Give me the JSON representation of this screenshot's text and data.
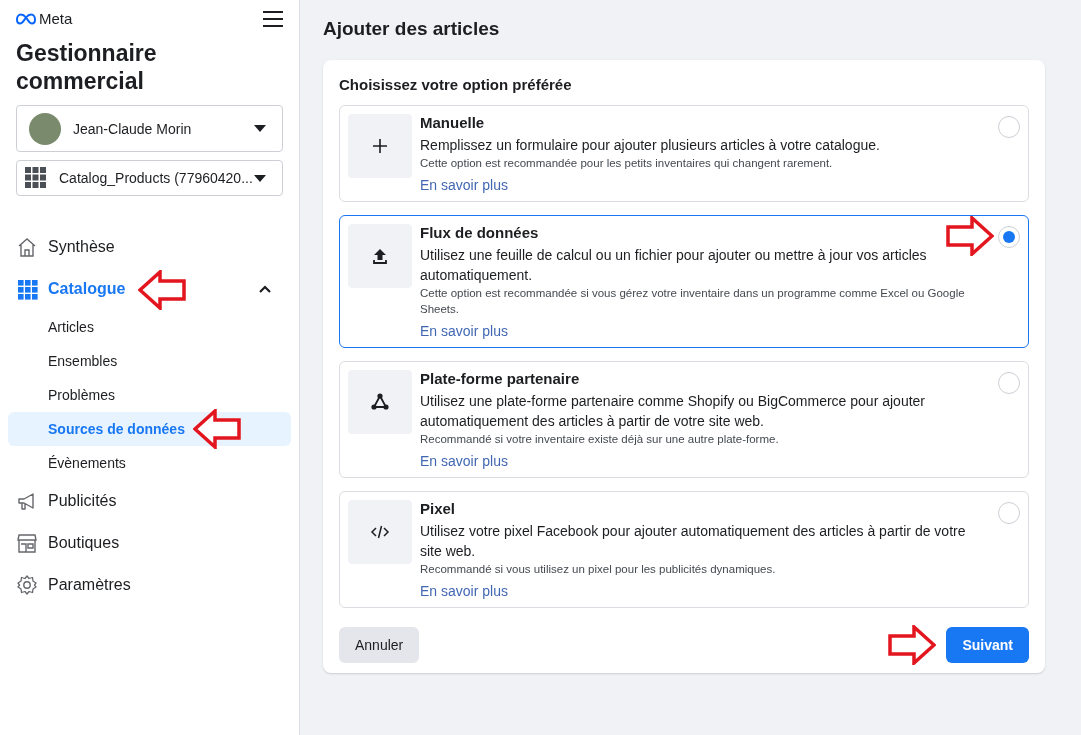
{
  "brand": {
    "name": "Meta"
  },
  "app_title": "Gestionnaire commercial",
  "account_selector": {
    "value": "Jean-Claude Morin"
  },
  "catalog_selector": {
    "value": "Catalog_Products (77960420..."
  },
  "nav": [
    {
      "label": "Synthèse",
      "selected": false,
      "annotated": false
    },
    {
      "label": "Catalogue",
      "selected": true,
      "expanded": true,
      "annotated": true,
      "children": [
        {
          "label": "Articles",
          "selected": false,
          "annotated": false
        },
        {
          "label": "Ensembles",
          "selected": false,
          "annotated": false
        },
        {
          "label": "Problèmes",
          "selected": false,
          "annotated": false
        },
        {
          "label": "Sources de données",
          "selected": true,
          "annotated": true
        },
        {
          "label": "Évènements",
          "selected": false,
          "annotated": false
        }
      ]
    },
    {
      "label": "Publicités",
      "selected": false,
      "annotated": false
    },
    {
      "label": "Boutiques",
      "selected": false,
      "annotated": false
    },
    {
      "label": "Paramètres",
      "selected": false,
      "annotated": false
    }
  ],
  "page_title": "Ajouter des articles",
  "card": {
    "heading": "Choisissez votre option préférée",
    "options": [
      {
        "title": "Manuelle",
        "description": "Remplissez un formulaire pour ajouter plusieurs articles à votre catalogue.",
        "note": "Cette option est recommandée pour les petits inventaires qui changent rarement.",
        "link": "En savoir plus",
        "selected": false,
        "annotated": false
      },
      {
        "title": "Flux de données",
        "description": "Utilisez une feuille de calcul ou un fichier pour ajouter ou mettre à jour vos articles automatiquement.",
        "note": "Cette option est recommandée si vous gérez votre inventaire dans un programme comme Excel ou Google Sheets.",
        "link": "En savoir plus",
        "selected": true,
        "annotated": true
      },
      {
        "title": "Plate-forme partenaire",
        "description": "Utilisez une plate-forme partenaire comme Shopify ou BigCommerce pour ajouter automatiquement des articles à partir de votre site web.",
        "note": "Recommandé si votre inventaire existe déjà sur une autre plate-forme.",
        "link": "En savoir plus",
        "selected": false,
        "annotated": false
      },
      {
        "title": "Pixel",
        "description": "Utilisez votre pixel Facebook pour ajouter automatiquement des articles à partir de votre site web.",
        "note": "Recommandé si vous utilisez un pixel pour les publicités dynamiques.",
        "link": "En savoir plus",
        "selected": false,
        "annotated": false
      }
    ],
    "cancel_button": "Annuler",
    "next_button": {
      "label": "Suivant",
      "annotated": true
    }
  }
}
